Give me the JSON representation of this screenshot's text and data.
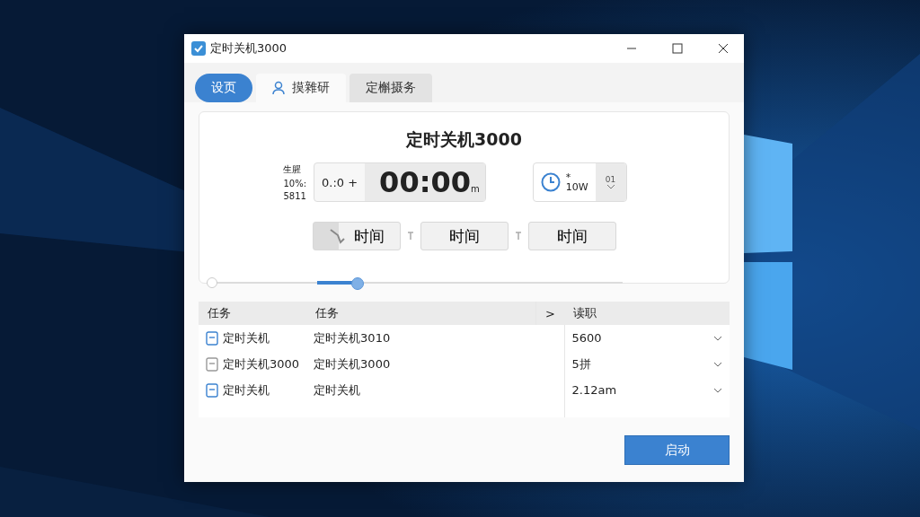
{
  "window": {
    "title": "定时关机3000"
  },
  "tabs": [
    {
      "label": "设页",
      "selected": true,
      "kind": "pill"
    },
    {
      "label": "摸雜研",
      "selected": false,
      "kind": "user"
    },
    {
      "label": "定槲摄务",
      "selected": false,
      "kind": "plain"
    }
  ],
  "panel": {
    "heading": "定时关机3000",
    "side_labels": [
      "生腥",
      "10%:",
      "5811"
    ],
    "spinner": {
      "value": "0.:0",
      "suffix": "+"
    },
    "time": "00:00",
    "time_unit": "m",
    "clock_field": {
      "top": "*",
      "value": "10W",
      "unit": "01"
    },
    "time_buttons": [
      {
        "label": "时间",
        "kind": "icon"
      },
      {
        "label": "时间",
        "kind": "plain"
      },
      {
        "label": "时间",
        "kind": "plain"
      }
    ],
    "slider": {
      "level": 0.36
    }
  },
  "table": {
    "columns": [
      "任务",
      "任务",
      ">",
      "读职"
    ],
    "rows": [
      {
        "name": "定时关机",
        "detail": "定时关机3010",
        "reading": "5600",
        "kind": "blue"
      },
      {
        "name": "定时关机3000",
        "detail": "定时关机3000",
        "reading": "5拼",
        "kind": "plain"
      },
      {
        "name": "定时关机",
        "detail": "定时关机",
        "reading": "2.12am",
        "kind": "blue"
      }
    ]
  },
  "start_button": "启动"
}
